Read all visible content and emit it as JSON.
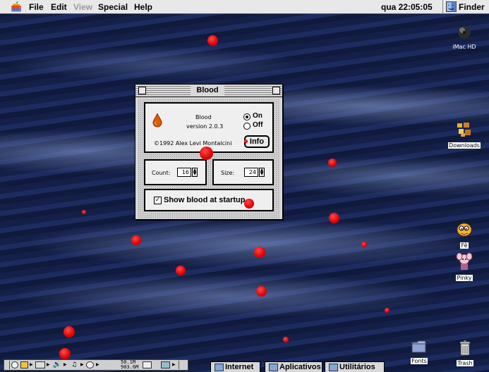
{
  "menubar": {
    "items": [
      "File",
      "Edit",
      "View",
      "Special",
      "Help"
    ],
    "clock": "qua 22:05:05",
    "app": "Finder"
  },
  "desktop_icons": {
    "hd": "iMac HD",
    "downloads": "Downloads",
    "fe": "Fê",
    "pinky": "Pinky",
    "fonts": "Fonts",
    "trash": "Trash"
  },
  "window": {
    "title": "Blood",
    "app_name": "Blood",
    "version": "version 2.0.3",
    "copyright": "©1992 Alex Levi Montalcini",
    "radio_on": "On",
    "radio_off": "Off",
    "info_button": "Info",
    "count_label": "Count:",
    "count_value": "16",
    "size_label": "Size:",
    "size_value": "24",
    "checkbox_label": "Show blood at startup",
    "checkbox_checked": true,
    "radio_selected": "On"
  },
  "control_strip": {
    "memory_top": "50.1M",
    "memory_bottom": "903.6M"
  },
  "tabs": [
    "Internet",
    "Aplicativos",
    "Utilitários"
  ],
  "colors": {
    "blood": "#e00000",
    "desktop": "#14204a",
    "menubar": "#e8e8e8"
  }
}
